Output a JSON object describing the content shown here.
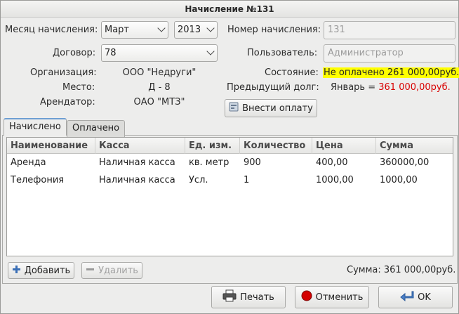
{
  "window": {
    "title": "Начисление №131"
  },
  "form": {
    "month_label": "Месяц начисления:",
    "month_value": "Март",
    "year_value": "2013",
    "number_label": "Номер начисления:",
    "number_value": "131",
    "contract_label": "Договор:",
    "contract_value": "78",
    "user_label": "Пользователь:",
    "user_value": "Администратор",
    "org_label": "Организация:",
    "org_value": "ООО \"Недруги\"",
    "place_label": "Место:",
    "place_value": "Д - 8",
    "tenant_label": "Арендатор:",
    "tenant_value": "ОАО \"МТЗ\"",
    "state_label": "Состояние:",
    "state_value": "Не оплачено 261 000,00руб.",
    "debt_label": "Предыдущий долг:",
    "debt_month": "Январь =",
    "debt_amount": "361 000,00руб.",
    "pay_button": "Внести оплату"
  },
  "tabs": [
    {
      "label": "Начислено",
      "active": true
    },
    {
      "label": "Оплачено",
      "active": false
    }
  ],
  "table": {
    "columns": [
      "Наименование",
      "Касса",
      "Ед. изм.",
      "Количество",
      "Цена",
      "Сумма"
    ],
    "rows": [
      [
        "Аренда",
        "Наличная касса",
        "кв. метр",
        "900",
        "400,00",
        "360000,00"
      ],
      [
        "Телефония",
        "Наличная касса",
        "Усл.",
        "1",
        "1000,00",
        "1000,00"
      ]
    ]
  },
  "actions": {
    "add": "Добавить",
    "delete": "Удалить",
    "total": "Сумма: 361 000,00руб."
  },
  "footer": {
    "print": "Печать",
    "cancel": "Отменить",
    "ok": "OK"
  },
  "colors": {
    "status_highlight": "#ffff00",
    "debt_red": "#d80000",
    "tab_accent": "#6e9fd3"
  },
  "icons": [
    "chevron-down-icon",
    "payment-icon",
    "plus-icon",
    "minus-icon",
    "printer-icon",
    "cancel-icon",
    "ok-arrow-icon"
  ]
}
